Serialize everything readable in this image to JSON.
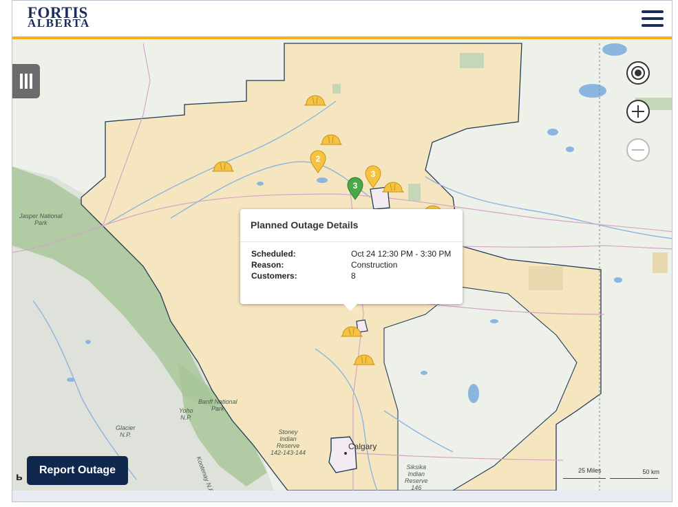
{
  "brand": {
    "line1": "FORTIS",
    "line2": "ALBERTA",
    "accent": "#f5b21b",
    "navy": "#1a2d5a"
  },
  "header": {
    "menu_icon": "hamburger-menu-icon"
  },
  "map": {
    "labels": {
      "calgary": "Calgary",
      "jasper": "Jasper National\nPark",
      "banff": "Banff National\nPark",
      "yoho": "Yoho\nN.P.",
      "glacier": "Glacier\nN.P.",
      "kootenay": "Kootenay N.P.",
      "stoney": "Stoney\nIndian\nReserve\n142-143-144",
      "siksika": "Siksika\nIndian\nReserve\n146"
    },
    "scale": {
      "miles": "25 Miles",
      "km": "50 km"
    },
    "markers": {
      "cluster_yellow_a": "2",
      "cluster_yellow_b": "3",
      "cluster_green": "3"
    }
  },
  "popup": {
    "title": "Planned Outage Details",
    "rows": [
      {
        "label": "Scheduled:",
        "value": "Oct 24 12:30 PM - 3:30 PM"
      },
      {
        "label": "Reason:",
        "value": "Construction"
      },
      {
        "label": "Customers:",
        "value": "8"
      }
    ]
  },
  "actions": {
    "report_outage": "Report Outage"
  },
  "colors": {
    "service_area": "#f6e6bf",
    "parks": "#a8c89a",
    "water": "#8ab5de",
    "marker_yellow": "#f5c242",
    "marker_green": "#4aa84a"
  }
}
